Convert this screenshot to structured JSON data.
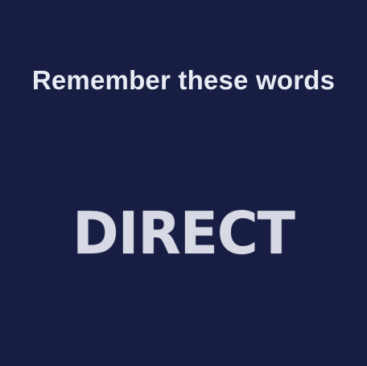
{
  "instruction": {
    "text": "Remember these words"
  },
  "word": {
    "text": "DIRECT"
  },
  "colors": {
    "background": "#181e43",
    "instruction_text": "#e8ebf3",
    "word_text": "#d7d9e4"
  }
}
